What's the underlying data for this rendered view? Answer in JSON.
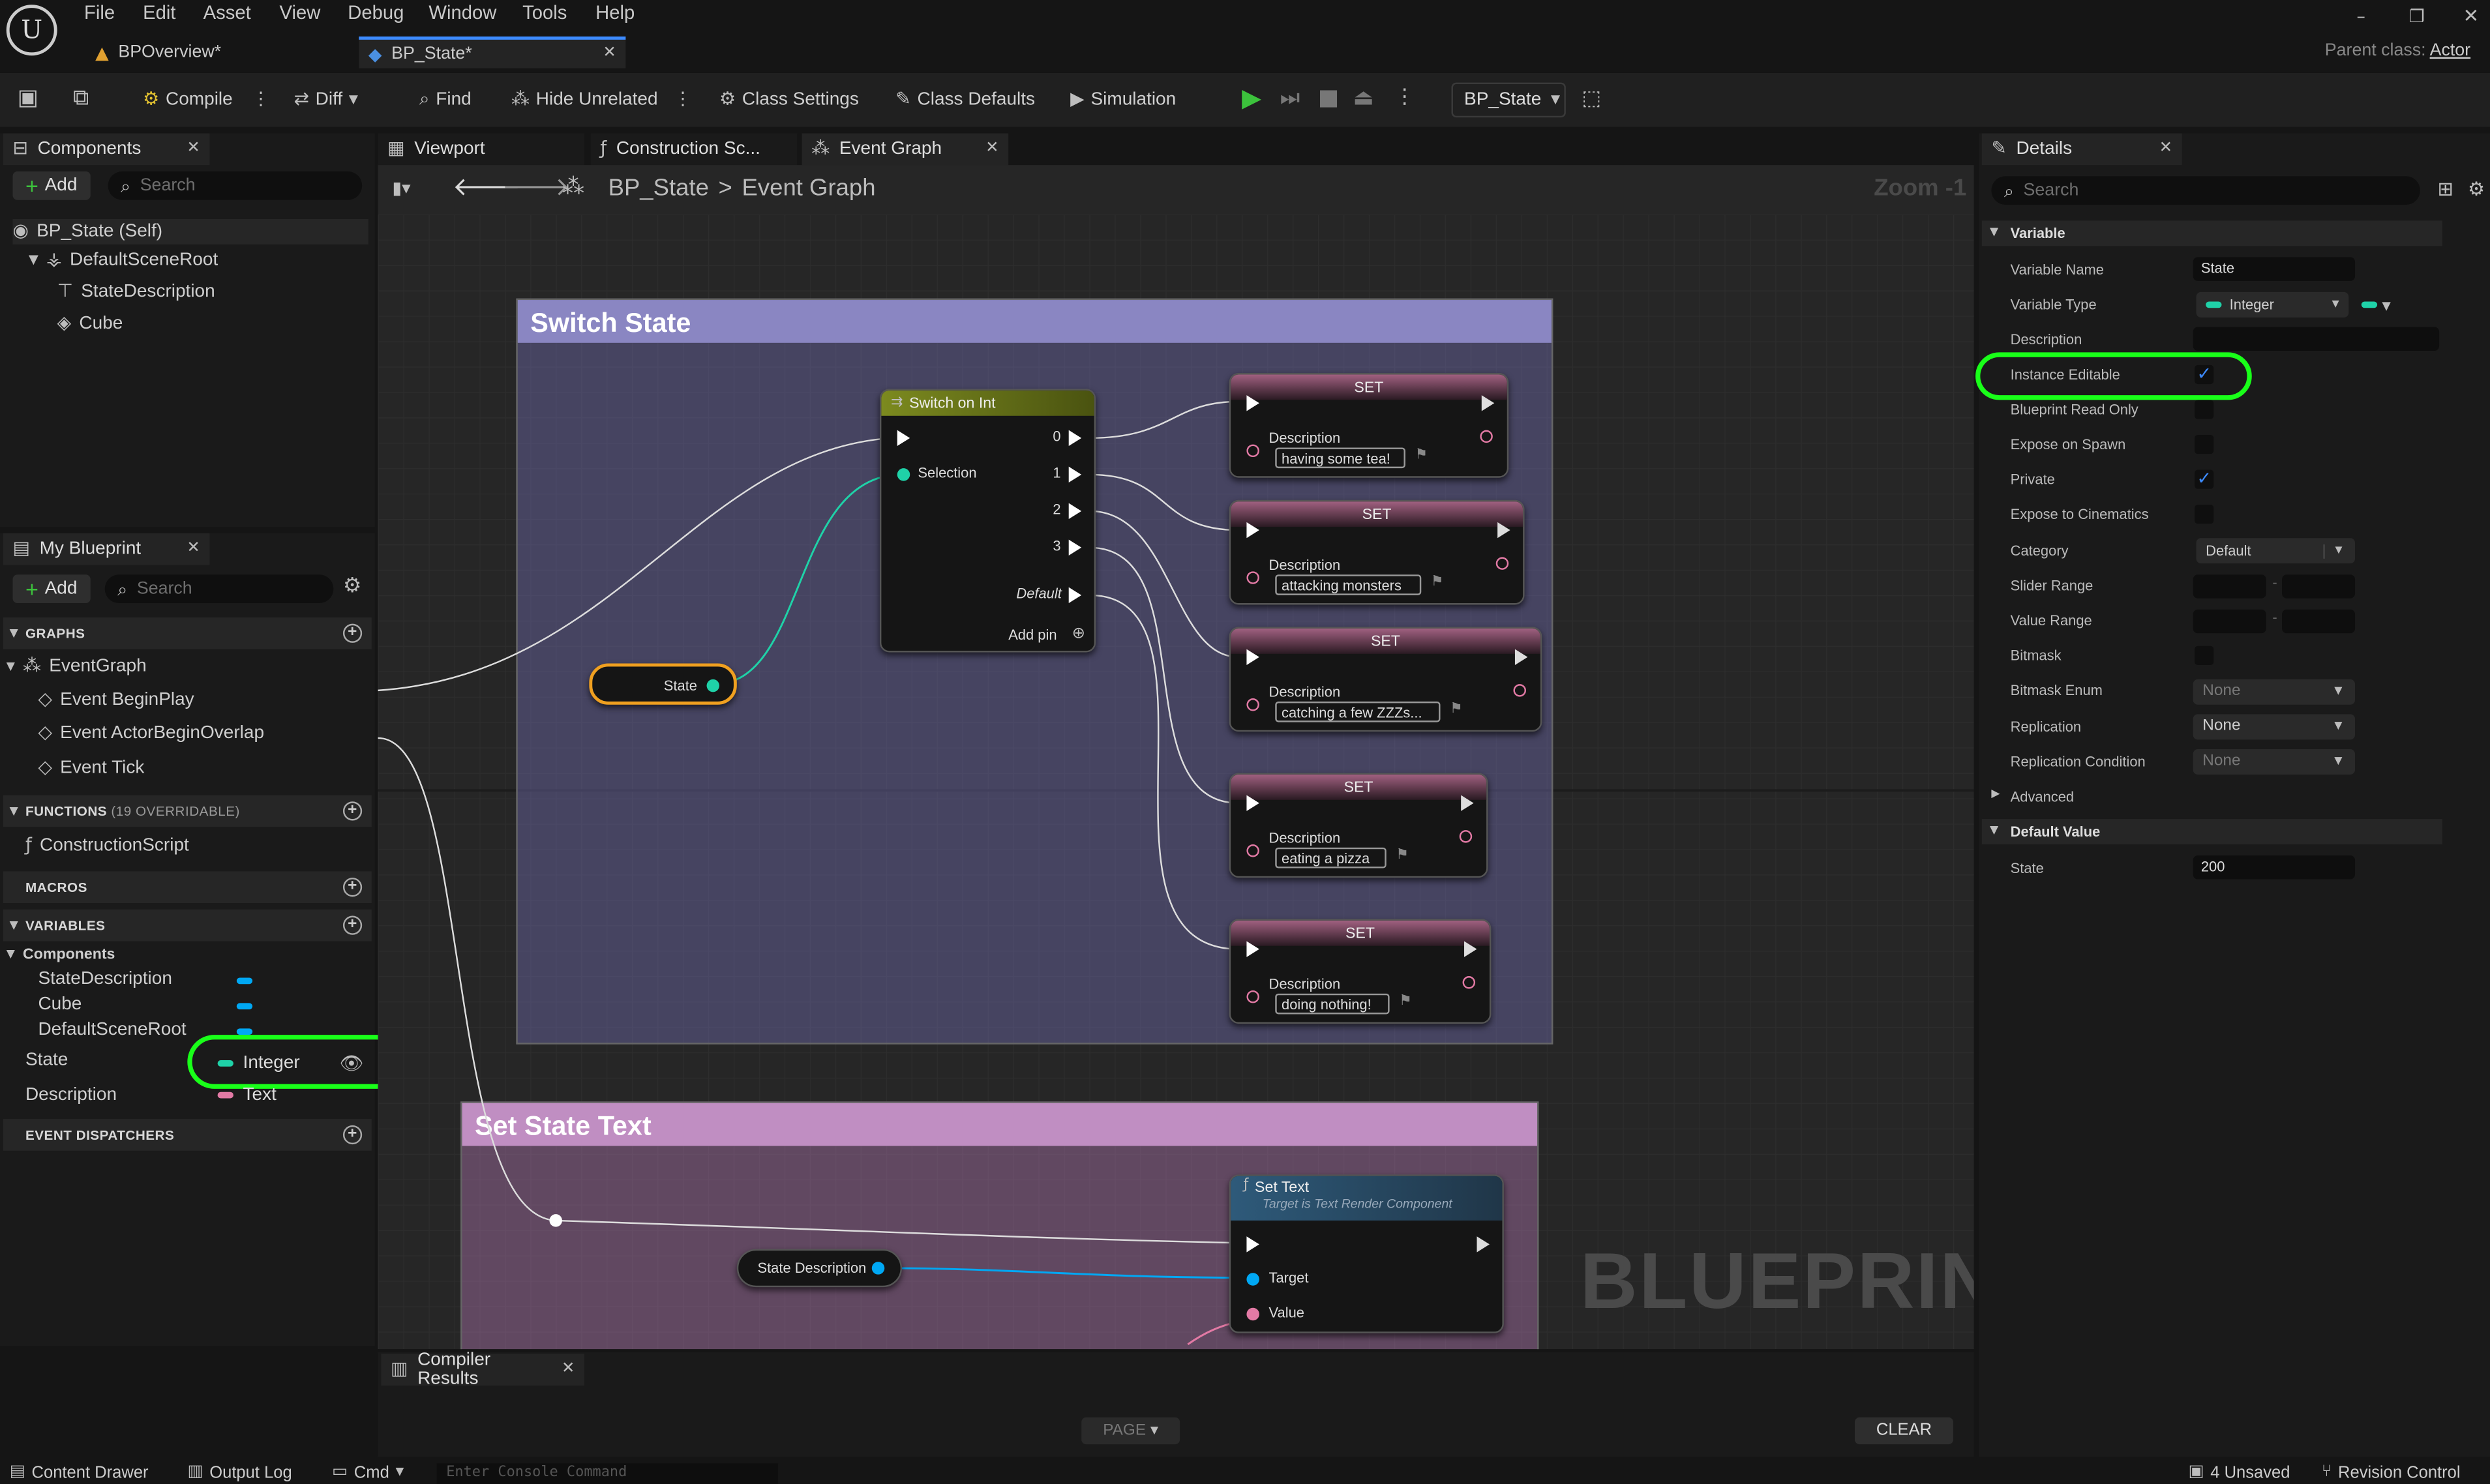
{
  "menu": [
    "File",
    "Edit",
    "Asset",
    "View",
    "Debug",
    "Window",
    "Tools",
    "Help"
  ],
  "doc_tabs": [
    {
      "label": "BPOverview*"
    },
    {
      "label": "BP_State*"
    }
  ],
  "parent_class": {
    "label": "Parent class:",
    "value": "Actor"
  },
  "toolbar": {
    "compile": "Compile",
    "diff": "Diff",
    "find": "Find",
    "hide_unrelated": "Hide Unrelated",
    "class_settings": "Class Settings",
    "class_defaults": "Class Defaults",
    "simulation": "Simulation",
    "debug_object": "BP_State"
  },
  "components": {
    "tab": "Components",
    "add": "Add",
    "search": "Search",
    "items": [
      "BP_State (Self)",
      "DefaultSceneRoot",
      "StateDescription",
      "Cube"
    ]
  },
  "my_blueprint": {
    "tab": "My Blueprint",
    "add": "Add",
    "search": "Search",
    "graphs_header": "GRAPHS",
    "event_graph": "EventGraph",
    "events": [
      "Event BeginPlay",
      "Event ActorBeginOverlap",
      "Event Tick"
    ],
    "functions_header": "FUNCTIONS",
    "functions_note": "(19 OVERRIDABLE)",
    "construction_script": "ConstructionScript",
    "macros_header": "MACROS",
    "variables_header": "VARIABLES",
    "components_category": "Components",
    "component_vars": [
      "StateDescription",
      "Cube",
      "DefaultSceneRoot"
    ],
    "var_state": {
      "name": "State",
      "type": "Integer"
    },
    "var_description": {
      "name": "Description",
      "type": "Text"
    },
    "dispatchers_header": "EVENT DISPATCHERS"
  },
  "graph_tabs": {
    "viewport": "Viewport",
    "construction": "Construction Sc...",
    "event_graph": "Event Graph"
  },
  "breadcrumb": {
    "bp": "BP_State",
    "sep": ">",
    "graph": "Event Graph"
  },
  "zoom": "Zoom -1",
  "watermark": "BLUEPRINT",
  "comments": {
    "switch_state": "Switch State",
    "set_state_text": "Set State Text"
  },
  "switch_node": {
    "title": "Switch on Int",
    "selection": "Selection",
    "outs": [
      "0",
      "1",
      "2",
      "3"
    ],
    "default": "Default",
    "add_pin": "Add pin"
  },
  "state_getter": "State",
  "set_nodes": [
    {
      "title": "SET",
      "label": "Description",
      "value": "having some tea!"
    },
    {
      "title": "SET",
      "label": "Description",
      "value": "attacking monsters"
    },
    {
      "title": "SET",
      "label": "Description",
      "value": "catching a few ZZZs..."
    },
    {
      "title": "SET",
      "label": "Description",
      "value": "eating a pizza"
    },
    {
      "title": "SET",
      "label": "Description",
      "value": "doing nothing!"
    }
  ],
  "state_desc_getter": "State Description",
  "set_text_node": {
    "title": "Set Text",
    "subtitle": "Target is Text Render Component",
    "target": "Target",
    "value": "Value"
  },
  "compiler": {
    "tab": "Compiler Results",
    "page": "PAGE",
    "clear": "CLEAR"
  },
  "details": {
    "tab": "Details",
    "search": "Search",
    "variable_header": "Variable",
    "variable_name_label": "Variable Name",
    "variable_name": "State",
    "variable_type_label": "Variable Type",
    "variable_type": "Integer",
    "description_label": "Description",
    "instance_editable_label": "Instance Editable",
    "instance_editable": true,
    "bp_read_only_label": "Blueprint Read Only",
    "expose_spawn_label": "Expose on Spawn",
    "private_label": "Private",
    "private": true,
    "expose_cinematics_label": "Expose to Cinematics",
    "category_label": "Category",
    "category": "Default",
    "slider_range_label": "Slider Range",
    "value_range_label": "Value Range",
    "bitmask_label": "Bitmask",
    "bitmask_enum_label": "Bitmask Enum",
    "bitmask_enum": "None",
    "replication_label": "Replication",
    "replication": "None",
    "rep_condition_label": "Replication Condition",
    "rep_condition": "None",
    "advanced": "Advanced",
    "default_value_header": "Default Value",
    "state_label": "State",
    "state_value": "200"
  },
  "statusbar": {
    "content_drawer": "Content Drawer",
    "output_log": "Output Log",
    "cmd": "Cmd",
    "console_placeholder": "Enter Console Command",
    "unsaved": "4 Unsaved",
    "revision": "Revision Control"
  },
  "colors": {
    "highlight": "#19ff19",
    "integer": "#1fd2a8",
    "text_pin": "#e37aa5",
    "object_pin": "#00a8f4",
    "comment_switch": "#6f6aa5",
    "comment_text": "#a875a8"
  }
}
